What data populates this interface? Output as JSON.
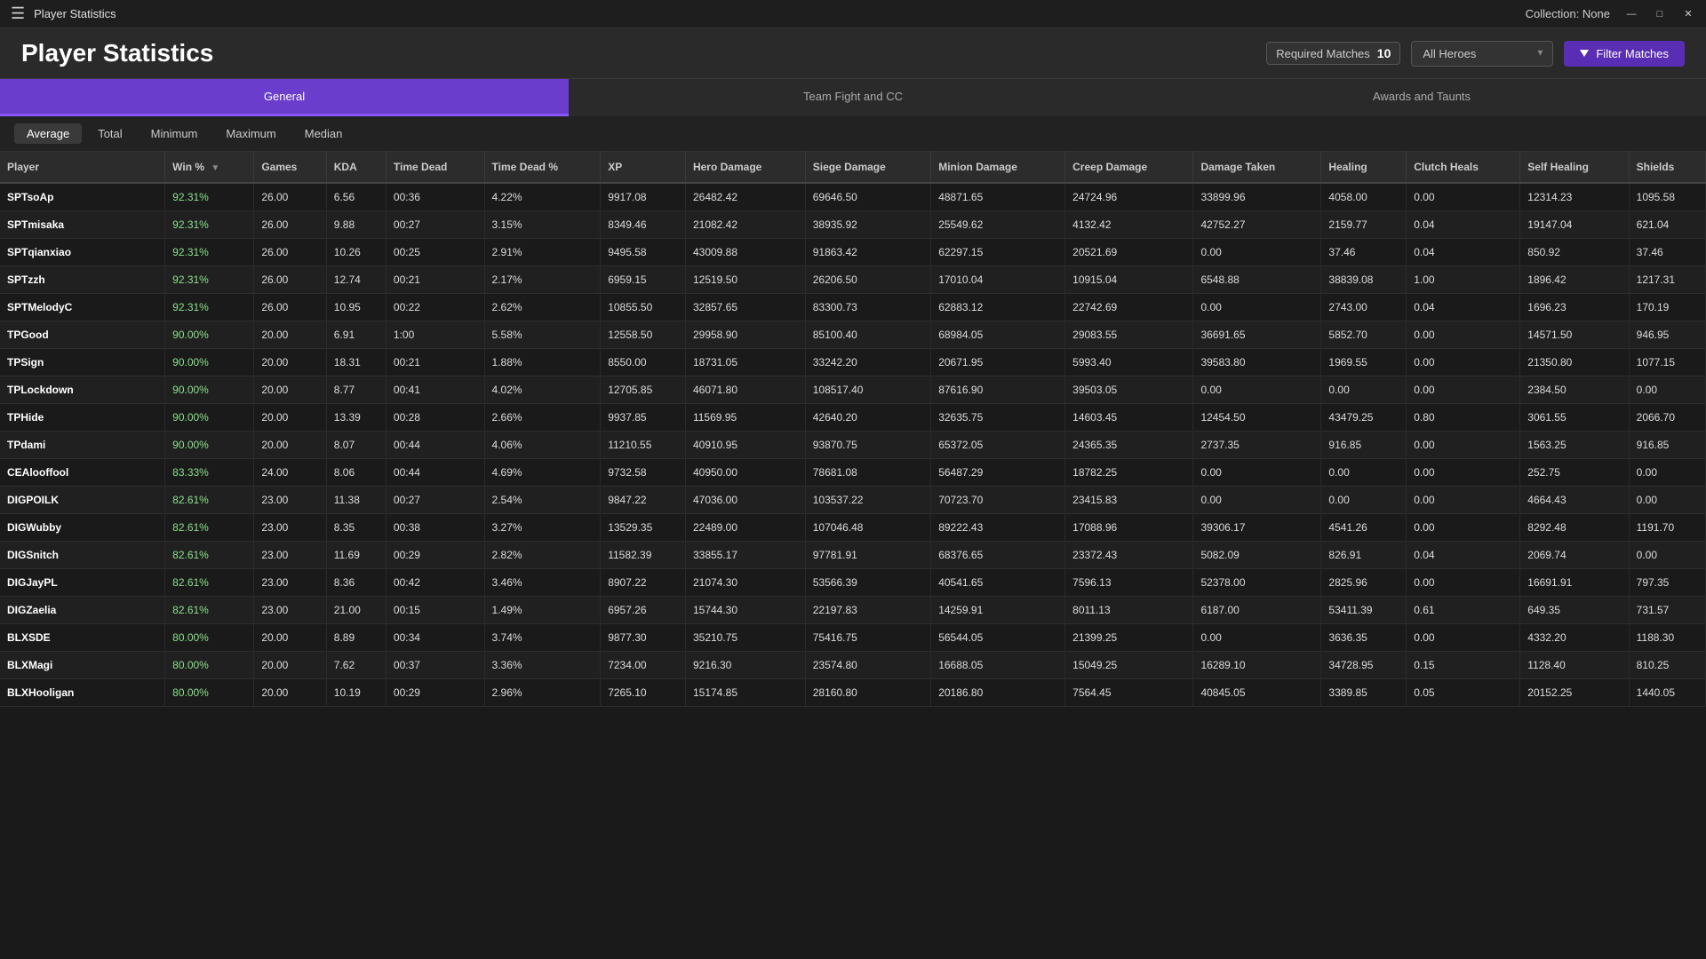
{
  "titlebar": {
    "menu_icon": "☰",
    "app_name": "Player Statistics",
    "collection_label": "Collection: None",
    "minimize_label": "—",
    "maximize_label": "□",
    "close_label": "✕"
  },
  "header": {
    "title": "Player Statistics",
    "required_matches_label": "Required Matches",
    "required_matches_value": "10",
    "hero_placeholder": "All Heroes",
    "filter_btn_label": "Filter Matches"
  },
  "main_tabs": [
    {
      "label": "General",
      "active": true
    },
    {
      "label": "Team Fight and CC",
      "active": false
    },
    {
      "label": "Awards and Taunts",
      "active": false
    }
  ],
  "sub_tabs": [
    {
      "label": "Average",
      "active": true
    },
    {
      "label": "Total",
      "active": false
    },
    {
      "label": "Minimum",
      "active": false
    },
    {
      "label": "Maximum",
      "active": false
    },
    {
      "label": "Median",
      "active": false
    }
  ],
  "table": {
    "columns": [
      "Player",
      "Win %",
      "Games",
      "KDA",
      "Time Dead",
      "Time Dead %",
      "XP",
      "Hero Damage",
      "Siege Damage",
      "Minion Damage",
      "Creep Damage",
      "Damage Taken",
      "Healing",
      "Clutch Heals",
      "Self Healing",
      "Shields"
    ],
    "rows": [
      [
        "SPTsoAp",
        "92.31%",
        "26.00",
        "6.56",
        "00:36",
        "4.22%",
        "9917.08",
        "26482.42",
        "69646.50",
        "48871.65",
        "24724.96",
        "33899.96",
        "4058.00",
        "0.00",
        "12314.23",
        "1095.58"
      ],
      [
        "SPTmisaka",
        "92.31%",
        "26.00",
        "9.88",
        "00:27",
        "3.15%",
        "8349.46",
        "21082.42",
        "38935.92",
        "25549.62",
        "4132.42",
        "42752.27",
        "2159.77",
        "0.04",
        "19147.04",
        "621.04"
      ],
      [
        "SPTqianxiao",
        "92.31%",
        "26.00",
        "10.26",
        "00:25",
        "2.91%",
        "9495.58",
        "43009.88",
        "91863.42",
        "62297.15",
        "20521.69",
        "0.00",
        "37.46",
        "0.04",
        "850.92",
        "37.46"
      ],
      [
        "SPTzzh",
        "92.31%",
        "26.00",
        "12.74",
        "00:21",
        "2.17%",
        "6959.15",
        "12519.50",
        "26206.50",
        "17010.04",
        "10915.04",
        "6548.88",
        "38839.08",
        "1.00",
        "1896.42",
        "1217.31"
      ],
      [
        "SPTMelodyC",
        "92.31%",
        "26.00",
        "10.95",
        "00:22",
        "2.62%",
        "10855.50",
        "32857.65",
        "83300.73",
        "62883.12",
        "22742.69",
        "0.00",
        "2743.00",
        "0.04",
        "1696.23",
        "170.19"
      ],
      [
        "TPGood",
        "90.00%",
        "20.00",
        "6.91",
        "1:00",
        "5.58%",
        "12558.50",
        "29958.90",
        "85100.40",
        "68984.05",
        "29083.55",
        "36691.65",
        "5852.70",
        "0.00",
        "14571.50",
        "946.95"
      ],
      [
        "TPSign",
        "90.00%",
        "20.00",
        "18.31",
        "00:21",
        "1.88%",
        "8550.00",
        "18731.05",
        "33242.20",
        "20671.95",
        "5993.40",
        "39583.80",
        "1969.55",
        "0.00",
        "21350.80",
        "1077.15"
      ],
      [
        "TPLockdown",
        "90.00%",
        "20.00",
        "8.77",
        "00:41",
        "4.02%",
        "12705.85",
        "46071.80",
        "108517.40",
        "87616.90",
        "39503.05",
        "0.00",
        "0.00",
        "0.00",
        "2384.50",
        "0.00"
      ],
      [
        "TPHide",
        "90.00%",
        "20.00",
        "13.39",
        "00:28",
        "2.66%",
        "9937.85",
        "11569.95",
        "42640.20",
        "32635.75",
        "14603.45",
        "12454.50",
        "43479.25",
        "0.80",
        "3061.55",
        "2066.70"
      ],
      [
        "TPdami",
        "90.00%",
        "20.00",
        "8.07",
        "00:44",
        "4.06%",
        "11210.55",
        "40910.95",
        "93870.75",
        "65372.05",
        "24365.35",
        "2737.35",
        "916.85",
        "0.00",
        "1563.25",
        "916.85"
      ],
      [
        "CEAlooffool",
        "83.33%",
        "24.00",
        "8.06",
        "00:44",
        "4.69%",
        "9732.58",
        "40950.00",
        "78681.08",
        "56487.29",
        "18782.25",
        "0.00",
        "0.00",
        "0.00",
        "252.75",
        "0.00"
      ],
      [
        "DIGPOILK",
        "82.61%",
        "23.00",
        "11.38",
        "00:27",
        "2.54%",
        "9847.22",
        "47036.00",
        "103537.22",
        "70723.70",
        "23415.83",
        "0.00",
        "0.00",
        "0.00",
        "4664.43",
        "0.00"
      ],
      [
        "DIGWubby",
        "82.61%",
        "23.00",
        "8.35",
        "00:38",
        "3.27%",
        "13529.35",
        "22489.00",
        "107046.48",
        "89222.43",
        "17088.96",
        "39306.17",
        "4541.26",
        "0.00",
        "8292.48",
        "1191.70"
      ],
      [
        "DIGSnitch",
        "82.61%",
        "23.00",
        "11.69",
        "00:29",
        "2.82%",
        "11582.39",
        "33855.17",
        "97781.91",
        "68376.65",
        "23372.43",
        "5082.09",
        "826.91",
        "0.04",
        "2069.74",
        "0.00"
      ],
      [
        "DIGJayPL",
        "82.61%",
        "23.00",
        "8.36",
        "00:42",
        "3.46%",
        "8907.22",
        "21074.30",
        "53566.39",
        "40541.65",
        "7596.13",
        "52378.00",
        "2825.96",
        "0.00",
        "16691.91",
        "797.35"
      ],
      [
        "DIGZaelia",
        "82.61%",
        "23.00",
        "21.00",
        "00:15",
        "1.49%",
        "6957.26",
        "15744.30",
        "22197.83",
        "14259.91",
        "8011.13",
        "6187.00",
        "53411.39",
        "0.61",
        "649.35",
        "731.57"
      ],
      [
        "BLXSDE",
        "80.00%",
        "20.00",
        "8.89",
        "00:34",
        "3.74%",
        "9877.30",
        "35210.75",
        "75416.75",
        "56544.05",
        "21399.25",
        "0.00",
        "3636.35",
        "0.00",
        "4332.20",
        "1188.30"
      ],
      [
        "BLXMagi",
        "80.00%",
        "20.00",
        "7.62",
        "00:37",
        "3.36%",
        "7234.00",
        "9216.30",
        "23574.80",
        "16688.05",
        "15049.25",
        "16289.10",
        "34728.95",
        "0.15",
        "1128.40",
        "810.25"
      ],
      [
        "BLXHooligan",
        "80.00%",
        "20.00",
        "10.19",
        "00:29",
        "2.96%",
        "7265.10",
        "15174.85",
        "28160.80",
        "20186.80",
        "7564.45",
        "40845.05",
        "3389.85",
        "0.05",
        "20152.25",
        "1440.05"
      ]
    ]
  }
}
